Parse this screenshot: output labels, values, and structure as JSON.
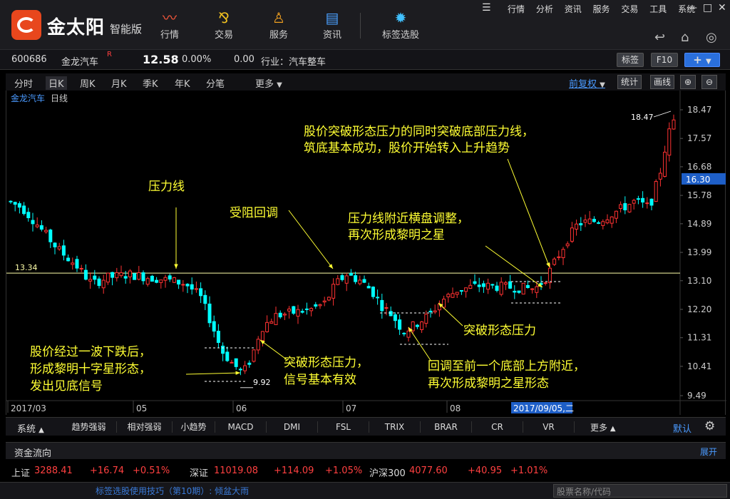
{
  "app": {
    "brand": "金太阳",
    "brand_sub": "智能版",
    "nav": [
      "行情",
      "交易",
      "服务",
      "资讯",
      "标签选股"
    ],
    "menu": [
      "行情",
      "分析",
      "资讯",
      "服务",
      "交易",
      "工具",
      "系统"
    ]
  },
  "quote": {
    "code": "600686",
    "name": "金龙汽车",
    "flag": "R",
    "price": "12.58",
    "pct": "0.00%",
    "chg": "0.00",
    "industry": "行业：汽车整车",
    "btn_tag": "标签",
    "btn_f10": "F10",
    "btn_plus": "+"
  },
  "period": {
    "tabs": [
      "分时",
      "日K",
      "周K",
      "月K",
      "季K",
      "年K",
      "分笔"
    ],
    "active": "日K",
    "more": "更多",
    "fq": "前复权",
    "stat": "统计",
    "draw": "画线"
  },
  "chart_title": {
    "name": "金龙汽车",
    "type": "日线"
  },
  "chart_data": {
    "type": "candlestick",
    "y_ticks": [
      "18.47",
      "17.57",
      "16.68",
      "15.78",
      "14.89",
      "13.99",
      "13.10",
      "12.20",
      "11.31",
      "10.41",
      "9.49"
    ],
    "ylim": [
      9.49,
      18.47
    ],
    "current_price": "16.30",
    "resistance": "13.34",
    "high_label": "18.47",
    "low_label": "9.92",
    "x_labels": [
      "2017/03",
      "05",
      "06",
      "07",
      "08"
    ],
    "cursor_date": "2017/09/05,二"
  },
  "annotations": {
    "resistance_line": "压力线",
    "pullback": "受阻回调",
    "consolidate_1": "压力线附近横盘调整，",
    "consolidate_2": "再次形成黎明之星",
    "breakthrough_1": "股价突破形态压力的同时突破底部压力线，",
    "breakthrough_2": "筑底基本成功，股价开始转入上升趋势",
    "break_pattern": "突破形态压力",
    "bottom_1": "股价经过一波下跌后，",
    "bottom_2": "形成黎明十字星形态，",
    "bottom_3": "发出见底信号",
    "valid_1": "突破形态压力，",
    "valid_2": "信号基本有效",
    "retrace_1": "回调至前一个底部上方附近，",
    "retrace_2": "再次形成黎明之星形态"
  },
  "indicators": {
    "system": "系统",
    "tabs": [
      "趋势强弱",
      "相对强弱",
      "小趋势",
      "MACD",
      "DMI",
      "FSL",
      "TRIX",
      "BRAR",
      "CR",
      "VR",
      "更多"
    ],
    "default": "默认"
  },
  "flow": {
    "label": "资金流向",
    "expand": "展开"
  },
  "status": {
    "sh_name": "上证",
    "sh_val": "3288.41",
    "sh_chg": "+16.74",
    "sh_pct": "+0.51%",
    "sz_name": "深证",
    "sz_val": "11019.08",
    "sz_chg": "+114.09",
    "sz_pct": "+1.05%",
    "hs_name": "沪深300",
    "hs_val": "4077.60",
    "hs_chg": "+40.95",
    "hs_pct": "+1.01%"
  },
  "footer": {
    "tip": "标签选股使用技巧（第10期）: 倾盆大雨",
    "search_placeholder": "股票名称/代码"
  },
  "colors": {
    "up": "#ff3232",
    "down": "#00ffff",
    "annotation": "#ffff33",
    "resistance": "#ffffaa"
  }
}
